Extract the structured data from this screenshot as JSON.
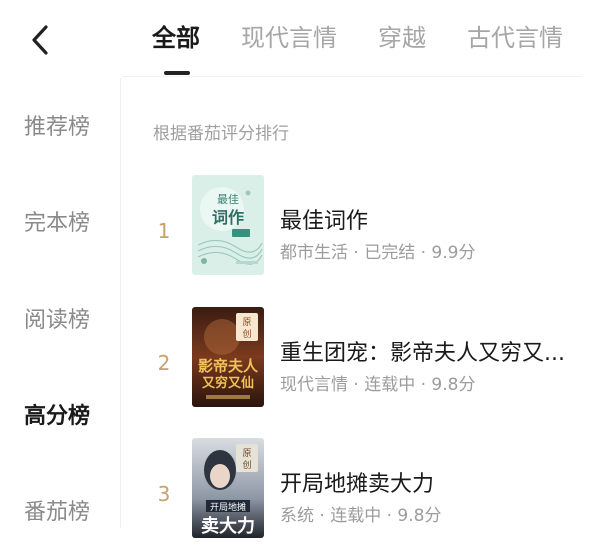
{
  "header": {
    "tabs": [
      {
        "label": "全部"
      },
      {
        "label": "现代言情"
      },
      {
        "label": "穿越"
      },
      {
        "label": "古代言情"
      }
    ]
  },
  "sidebar": {
    "items": [
      {
        "label": "推荐榜"
      },
      {
        "label": "完本榜"
      },
      {
        "label": "阅读榜"
      },
      {
        "label": "高分榜"
      },
      {
        "label": "番茄榜"
      }
    ]
  },
  "main": {
    "subtitle": "根据番茄评分排行",
    "books": [
      {
        "rank": "1",
        "title": "最佳词作",
        "meta": "都市生活 · 已完结 · 9.9分",
        "cover_text": "最佳词作"
      },
      {
        "rank": "2",
        "title": "重生团宠：影帝夫人又穷又...",
        "meta": "现代言情 · 连载中 · 9.8分",
        "cover_badge": "原创",
        "cover_text": "影帝夫人又穷又仙"
      },
      {
        "rank": "3",
        "title": "开局地摊卖大力",
        "meta": "系统 · 连载中 · 9.8分",
        "cover_badge": "原创",
        "cover_text": "开局地摊卖大力"
      }
    ]
  }
}
